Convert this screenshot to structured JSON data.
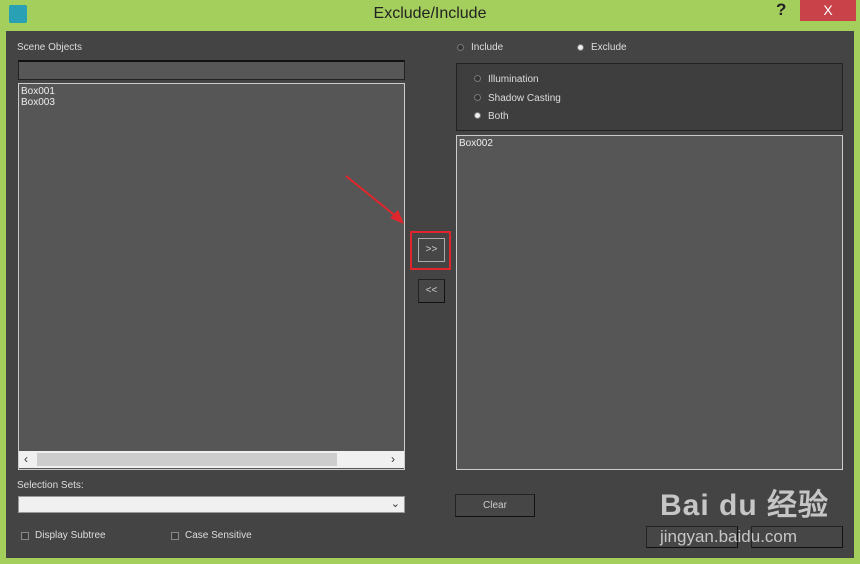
{
  "window": {
    "title": "Exclude/Include",
    "help": "?",
    "close": "X"
  },
  "left": {
    "scene_label": "Scene Objects",
    "filter_value": "",
    "objects": [
      "Box001",
      "Box003"
    ],
    "selection_sets_label": "Selection Sets:",
    "selection_value": "",
    "display_subtree": "Display Subtree",
    "case_sensitive": "Case Sensitive"
  },
  "middle": {
    "add": ">>",
    "remove": "<<"
  },
  "right": {
    "mode": {
      "include": "Include",
      "exclude": "Exclude",
      "selected": "Exclude"
    },
    "type": {
      "illumination": "Illumination",
      "shadow": "Shadow Casting",
      "both": "Both",
      "selected": "Both"
    },
    "objects": [
      "Box002"
    ],
    "clear": "Clear",
    "ok": "",
    "cancel": ""
  },
  "watermark": {
    "brand": "Bai du 经验",
    "url": "jingyan.baidu.com"
  },
  "colors": {
    "frame": "#a5cf5d",
    "highlight": "#e0262c",
    "close": "#c9424a"
  }
}
